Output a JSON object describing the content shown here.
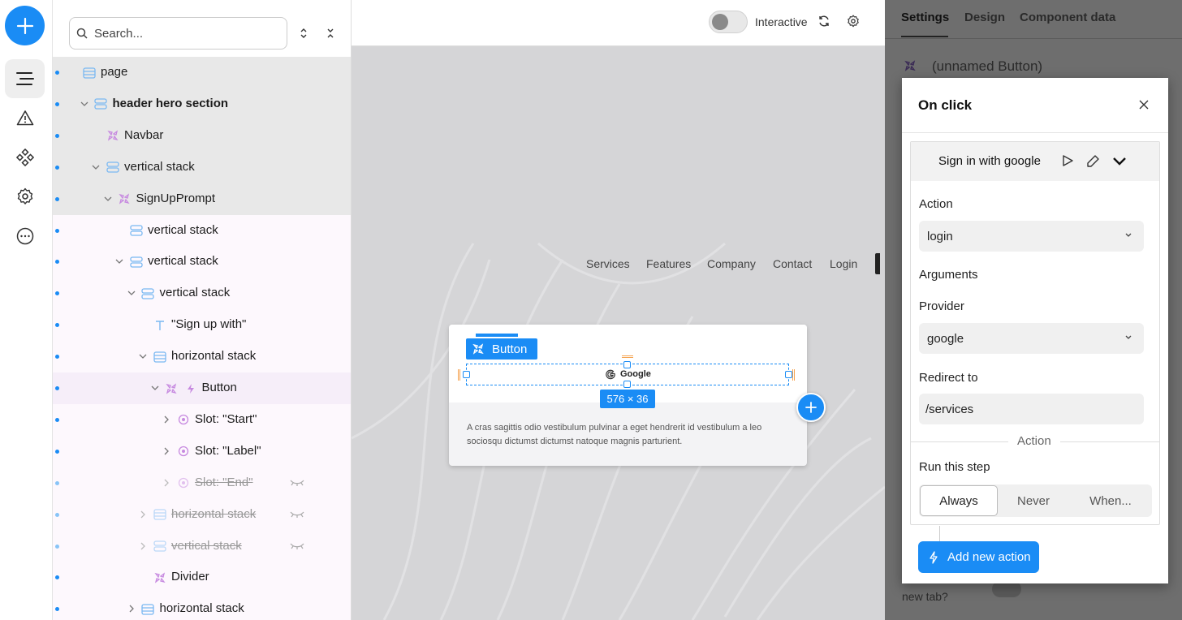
{
  "tree": {
    "search_placeholder": "Search...",
    "items": [
      {
        "label": "page",
        "depth": 0,
        "bold": false,
        "strike": false,
        "icon": "stack-h",
        "hidden": false
      },
      {
        "label": "header hero section",
        "depth": 1,
        "bold": true,
        "strike": false,
        "icon": "stack-v",
        "hidden": false
      },
      {
        "label": "Navbar",
        "depth": 2,
        "bold": false,
        "strike": false,
        "icon": "component",
        "hidden": false
      },
      {
        "label": "vertical stack",
        "depth": 2,
        "bold": false,
        "strike": false,
        "icon": "stack-v",
        "hidden": false
      },
      {
        "label": "SignUpPrompt",
        "depth": 3,
        "bold": false,
        "strike": false,
        "icon": "component",
        "hidden": false
      },
      {
        "label": "vertical stack",
        "depth": 4,
        "bold": false,
        "strike": false,
        "icon": "stack-v",
        "hidden": false
      },
      {
        "label": "vertical stack",
        "depth": 4,
        "bold": false,
        "strike": false,
        "icon": "stack-v",
        "hidden": false
      },
      {
        "label": "vertical stack",
        "depth": 5,
        "bold": false,
        "strike": false,
        "icon": "stack-v",
        "hidden": false
      },
      {
        "label": "\"Sign up with\"",
        "depth": 6,
        "bold": false,
        "strike": false,
        "icon": "text",
        "hidden": false
      },
      {
        "label": "horizontal stack",
        "depth": 6,
        "bold": false,
        "strike": false,
        "icon": "stack-h",
        "hidden": false
      },
      {
        "label": "Button",
        "depth": 7,
        "bold": false,
        "strike": false,
        "icon": "component",
        "hidden": false
      },
      {
        "label": "Slot: \"Start\"",
        "depth": 8,
        "bold": false,
        "strike": false,
        "icon": "slot",
        "hidden": false
      },
      {
        "label": "Slot: \"Label\"",
        "depth": 8,
        "bold": false,
        "strike": false,
        "icon": "slot",
        "hidden": false
      },
      {
        "label": "Slot: \"End\"",
        "depth": 8,
        "bold": false,
        "strike": true,
        "icon": "slot",
        "hidden": true
      },
      {
        "label": "horizontal stack",
        "depth": 6,
        "bold": false,
        "strike": true,
        "icon": "stack-h",
        "hidden": true
      },
      {
        "label": "vertical stack",
        "depth": 6,
        "bold": false,
        "strike": true,
        "icon": "stack-v",
        "hidden": true
      },
      {
        "label": "Divider",
        "depth": 6,
        "bold": false,
        "strike": false,
        "icon": "component",
        "hidden": false
      },
      {
        "label": "horizontal stack",
        "depth": 5,
        "bold": false,
        "strike": false,
        "icon": "stack-h",
        "hidden": false
      }
    ]
  },
  "topbar": {
    "interactive_label": "Interactive"
  },
  "canvas": {
    "nav": [
      "Services",
      "Features",
      "Company",
      "Contact",
      "Login"
    ],
    "button_tag": "Button",
    "google_label": "Google",
    "dims_w": "576",
    "dims_x": "×",
    "dims_h": "36",
    "card_text": "A cras sagittis odio vestibulum pulvinar a eget hendrerit id vestibulum a leo sociosqu dictumst dictumst natoque magnis parturient."
  },
  "panel": {
    "tabs": [
      "Settings",
      "Design",
      "Component data"
    ],
    "component_name": "(unnamed Button)",
    "modal_title": "On click",
    "action_header": "Sign in with google",
    "action_label": "Action",
    "action_value": "login",
    "arguments_label": "Arguments",
    "provider_label": "Provider",
    "provider_value": "google",
    "redirect_label": "Redirect to",
    "redirect_value": "/services",
    "divider_label": "Action",
    "run_label": "Run this step",
    "run_options": [
      "Always",
      "Never",
      "When..."
    ],
    "add_action": "Add new action",
    "behind_text": "new tab?"
  },
  "colors": {
    "accent": "#1a8cf5",
    "component_purple": "#b06cd8"
  }
}
